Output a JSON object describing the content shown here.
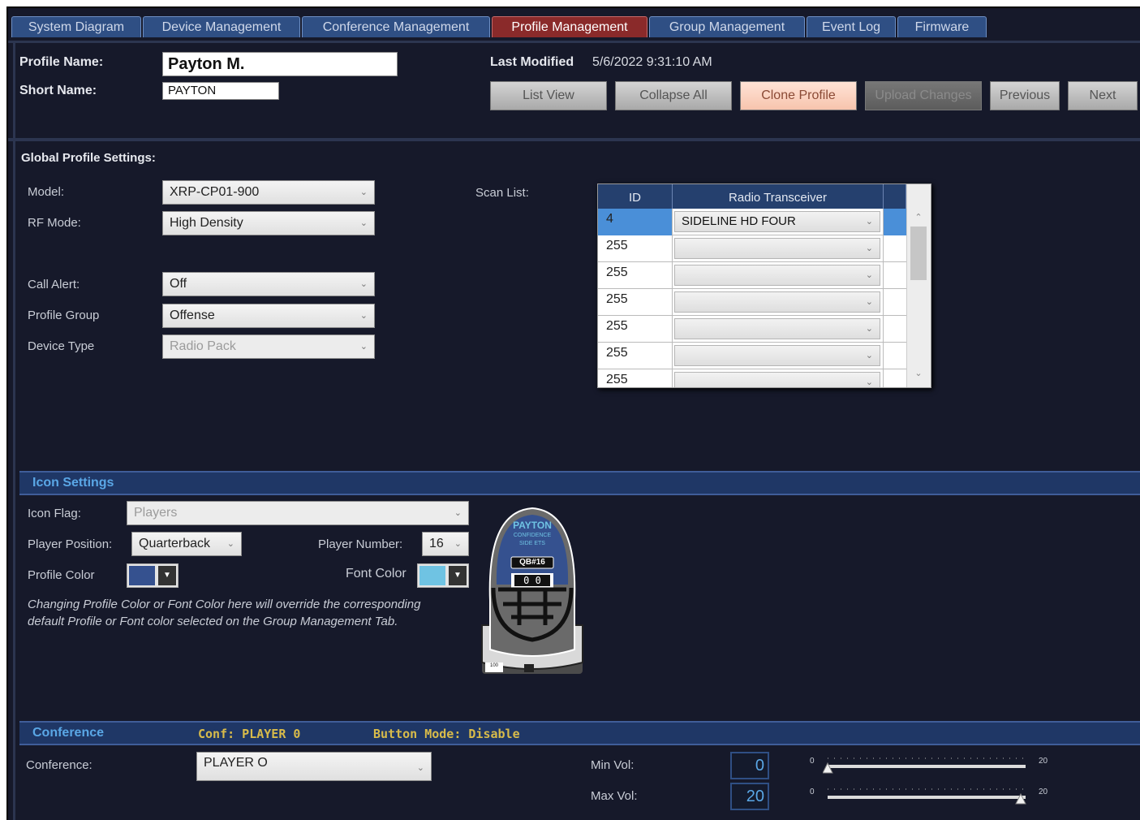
{
  "tabs": [
    {
      "label": "System Diagram",
      "active": false
    },
    {
      "label": "Device Management",
      "active": false
    },
    {
      "label": "Conference Management",
      "active": false
    },
    {
      "label": "Profile Management",
      "active": true
    },
    {
      "label": "Group Management",
      "active": false
    },
    {
      "label": "Event Log",
      "active": false
    },
    {
      "label": "Firmware",
      "active": false
    }
  ],
  "profile": {
    "name_label": "Profile Name:",
    "name_value": "Payton M.",
    "short_label": "Short Name:",
    "short_value": "PAYTON",
    "last_modified_label": "Last Modified",
    "last_modified_value": "5/6/2022 9:31:10 AM"
  },
  "buttons": {
    "list_view": "List View",
    "collapse_all": "Collapse All",
    "clone_profile": "Clone Profile",
    "upload_changes": "Upload Changes",
    "previous": "Previous",
    "next": "Next"
  },
  "global": {
    "title": "Global Profile Settings:",
    "model_label": "Model:",
    "model_value": "XRP-CP01-900",
    "rf_label": "RF Mode:",
    "rf_value": "High Density",
    "call_alert_label": "Call Alert:",
    "call_alert_value": "Off",
    "profile_group_label": "Profile Group",
    "profile_group_value": "Offense",
    "device_type_label": "Device Type",
    "device_type_value": "Radio Pack",
    "scan_list_label": "Scan List:"
  },
  "scan_grid": {
    "headers": {
      "id": "ID",
      "radio": "Radio Transceiver"
    },
    "rows": [
      {
        "id": "4",
        "radio": "SIDELINE HD FOUR"
      },
      {
        "id": "255",
        "radio": ""
      },
      {
        "id": "255",
        "radio": ""
      },
      {
        "id": "255",
        "radio": ""
      },
      {
        "id": "255",
        "radio": ""
      },
      {
        "id": "255",
        "radio": ""
      },
      {
        "id": "255",
        "radio": ""
      }
    ]
  },
  "icon_settings": {
    "title": "Icon Settings",
    "icon_flag_label": "Icon Flag:",
    "icon_flag_value": "Players",
    "position_label": "Player Position:",
    "position_value": "Quarterback",
    "number_label": "Player Number:",
    "number_value": "16",
    "profile_color_label": "Profile Color",
    "profile_color": "#35518f",
    "font_color_label": "Font Color",
    "font_color": "#6fc3e3",
    "note": "Changing Profile Color or Font Color here will override the corresponding default Profile or Font color selected on the Group Management Tab.",
    "preview": {
      "name": "PAYTON",
      "sub1": "CONFIDENCE",
      "sub2": "SIDE ETS",
      "tag": "QB#16",
      "digits": "0 0",
      "battery": "100"
    }
  },
  "conference": {
    "title": "Conference",
    "conf_status": "Conf: PLAYER 0",
    "button_mode": "Button Mode: Disable",
    "conference_label": "Conference:",
    "conference_value": "PLAYER O",
    "min_vol_label": "Min Vol:",
    "min_vol_value": "0",
    "max_vol_label": "Max Vol:",
    "max_vol_value": "20",
    "slider_min": "0",
    "slider_max": "20",
    "min_vol_level": 0,
    "max_vol_level": 20
  },
  "colors": {
    "active_tab": "#8a2a2a",
    "tab": "#2f4f84",
    "section_title": "#5aa7e6",
    "mono_text": "#d8bb4a",
    "background": "#16192a"
  }
}
